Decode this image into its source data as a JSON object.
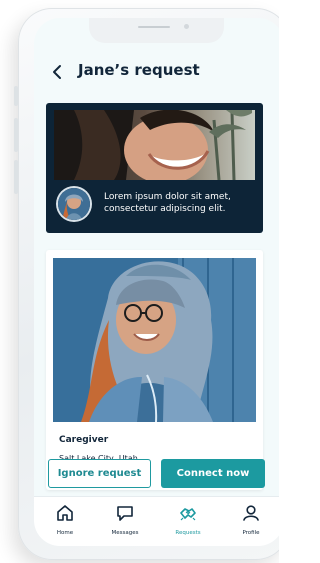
{
  "header": {
    "title": "Jane’s request"
  },
  "hero": {
    "text": "Lorem ipsum dolor sit amet, consectetur adipiscing elit."
  },
  "caregiver": {
    "title": "Caregiver",
    "location": "Salt Lake City, Utah"
  },
  "actions": {
    "ignore_label": "Ignore request",
    "connect_label": "Connect now"
  },
  "nav": {
    "items": [
      {
        "label": "Home",
        "icon": "home-icon",
        "active": false
      },
      {
        "label": "Messages",
        "icon": "message-icon",
        "active": false
      },
      {
        "label": "Requests",
        "icon": "handshake-icon",
        "active": true
      },
      {
        "label": "Profile",
        "icon": "user-icon",
        "active": false
      }
    ]
  },
  "colors": {
    "accent": "#1c9aa0",
    "navy": "#0d2437",
    "text": "#12263a",
    "screen_bg": "#f3fafb"
  }
}
